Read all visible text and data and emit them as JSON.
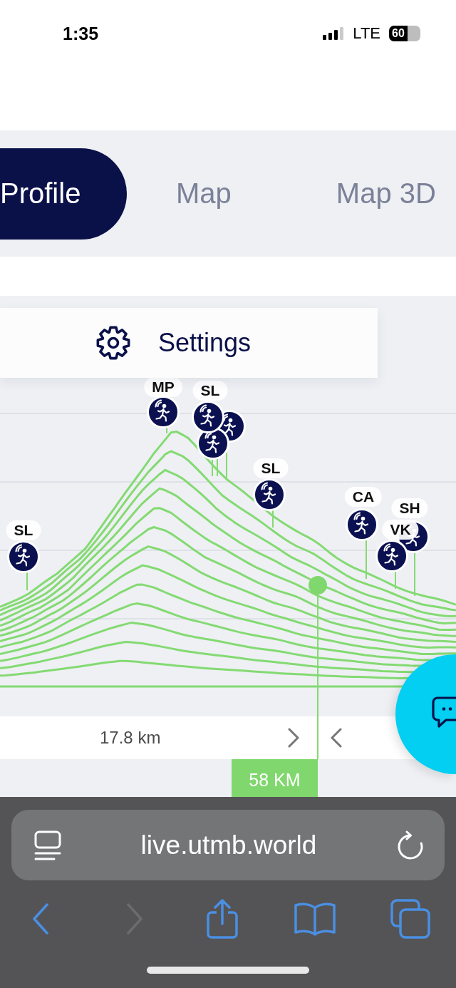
{
  "status_bar": {
    "time": "1:35",
    "network": "LTE",
    "battery": "60"
  },
  "tabs": [
    {
      "label": "Profile",
      "selected": true
    },
    {
      "label": "Map",
      "selected": false
    },
    {
      "label": "Map 3D",
      "selected": false
    }
  ],
  "settings": {
    "label": "Settings"
  },
  "elevation_profile": {
    "runners": [
      {
        "label": "MP"
      },
      {
        "label": "SL"
      },
      {
        "label": "SL"
      },
      {
        "label": "SL"
      },
      {
        "label": "CA"
      },
      {
        "label": "SH"
      },
      {
        "label": "VK"
      }
    ]
  },
  "range_bar": {
    "distance": "17.8 km",
    "marker": "58 KM"
  },
  "browser": {
    "url": "live.utmb.world",
    "toolbar": [
      {
        "kind": "back",
        "disabled": false
      },
      {
        "kind": "forward",
        "disabled": true
      },
      {
        "kind": "share",
        "disabled": false
      },
      {
        "kind": "bookmarks",
        "disabled": false
      },
      {
        "kind": "tabs",
        "disabled": false
      }
    ]
  }
}
